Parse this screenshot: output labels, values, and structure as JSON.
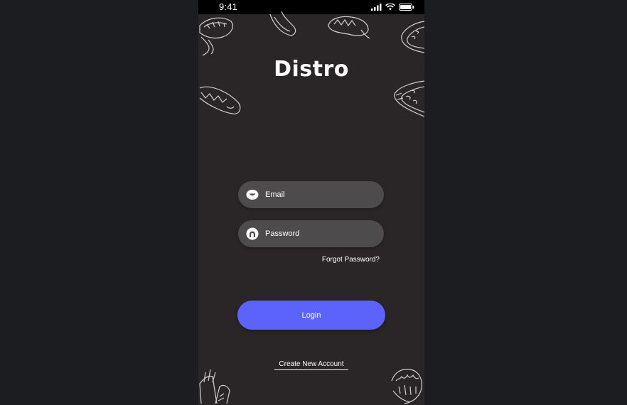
{
  "status_bar": {
    "time": "9:41",
    "icons": [
      "signal-icon",
      "wifi-icon",
      "battery-icon"
    ]
  },
  "app": {
    "name": "Distro"
  },
  "form": {
    "email_placeholder": "Email",
    "password_placeholder": "Password",
    "forgot_label": "Forgot Password?",
    "login_label": "Login",
    "create_account_label": "Create New Account"
  },
  "colors": {
    "background": "#1b1d21",
    "screen": "#2a2627",
    "field": "#4e4b4c",
    "accent": "#5b63fb",
    "text": "#ffffff"
  },
  "decorations": [
    "taco-doodle",
    "burrito-doodle",
    "hotdog-doodle",
    "pizza-doodle",
    "fries-doodle",
    "lettuce-doodle"
  ]
}
